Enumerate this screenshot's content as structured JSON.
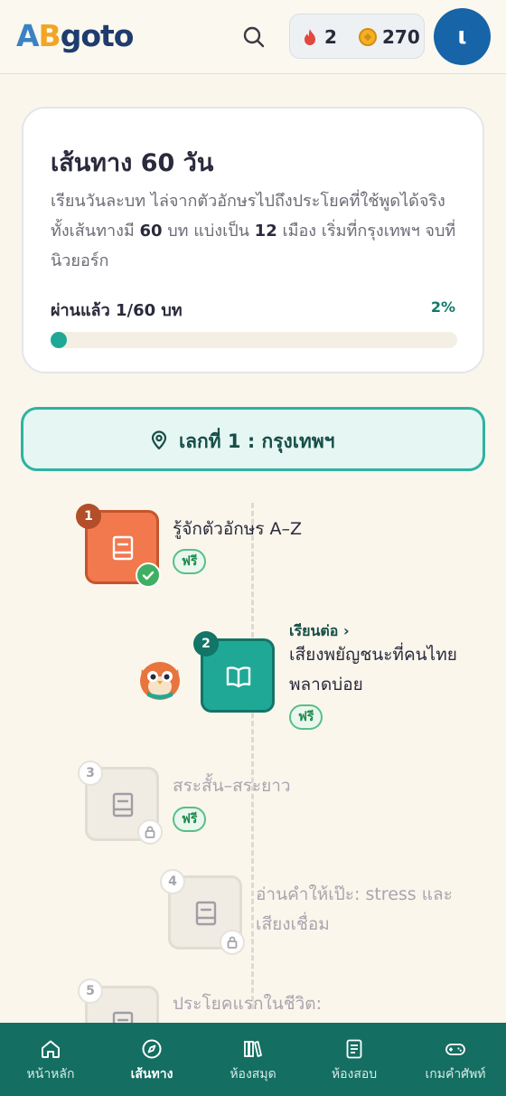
{
  "header": {
    "logo": {
      "a": "A",
      "b": "B",
      "rest": "goto"
    },
    "streak": "2",
    "coins": "270",
    "avatar_initial": "ι"
  },
  "course": {
    "title": "เส้นทาง 60 วัน",
    "desc_part1": "เรียนวันละบท ไล่จากตัวอักษรไปถึงประโยคที่ใช้พูดได้จริง ทั้งเส้นทางมี ",
    "lessons_total": "60",
    "desc_part2": " บท แบ่งเป็น ",
    "cities_total": "12",
    "desc_part3": " เมือง เริ่มที่กรุงเทพฯ จบที่นิวยอร์ก",
    "progress_label": "ผ่านแล้ว 1/60 บท",
    "progress_pct": "2%",
    "progress_value": 0.02
  },
  "stop": {
    "label": "เลกที่ 1 : กรุงเทพฯ"
  },
  "lessons": [
    {
      "number": "1",
      "title": "รู้จักตัวอักษร A–Z",
      "tag": "ฟรี",
      "state": "completed"
    },
    {
      "number": "2",
      "continue_label": "เรียนต่อ",
      "title": "เสียงพยัญชนะที่คนไทยพลาดบ่อย",
      "tag": "ฟรี",
      "state": "current"
    },
    {
      "number": "3",
      "title": "สระสั้น–สระยาว",
      "tag": "ฟรี",
      "state": "locked"
    },
    {
      "number": "4",
      "title": "อ่านคำให้เป๊ะ: stress และเสียงเชื่อม",
      "state": "locked"
    },
    {
      "number": "5",
      "title": "ประโยคแรกในชีวิต:",
      "state": "locked"
    }
  ],
  "nav": [
    {
      "label": "หน้าหลัก",
      "icon": "home-icon",
      "active": false
    },
    {
      "label": "เส้นทาง",
      "icon": "compass-icon",
      "active": true
    },
    {
      "label": "ห้องสมุด",
      "icon": "books-icon",
      "active": false
    },
    {
      "label": "ห้องสอบ",
      "icon": "exam-icon",
      "active": false
    },
    {
      "label": "เกมคำศัพท์",
      "icon": "gamepad-icon",
      "active": false
    }
  ],
  "colors": {
    "background": "#FAF6EC",
    "teal_primary": "#1FA896",
    "nav_bar": "#146E61",
    "lesson_done": "#F2784E",
    "free_tag": "#58BF87",
    "avatar": "#1764A8"
  }
}
